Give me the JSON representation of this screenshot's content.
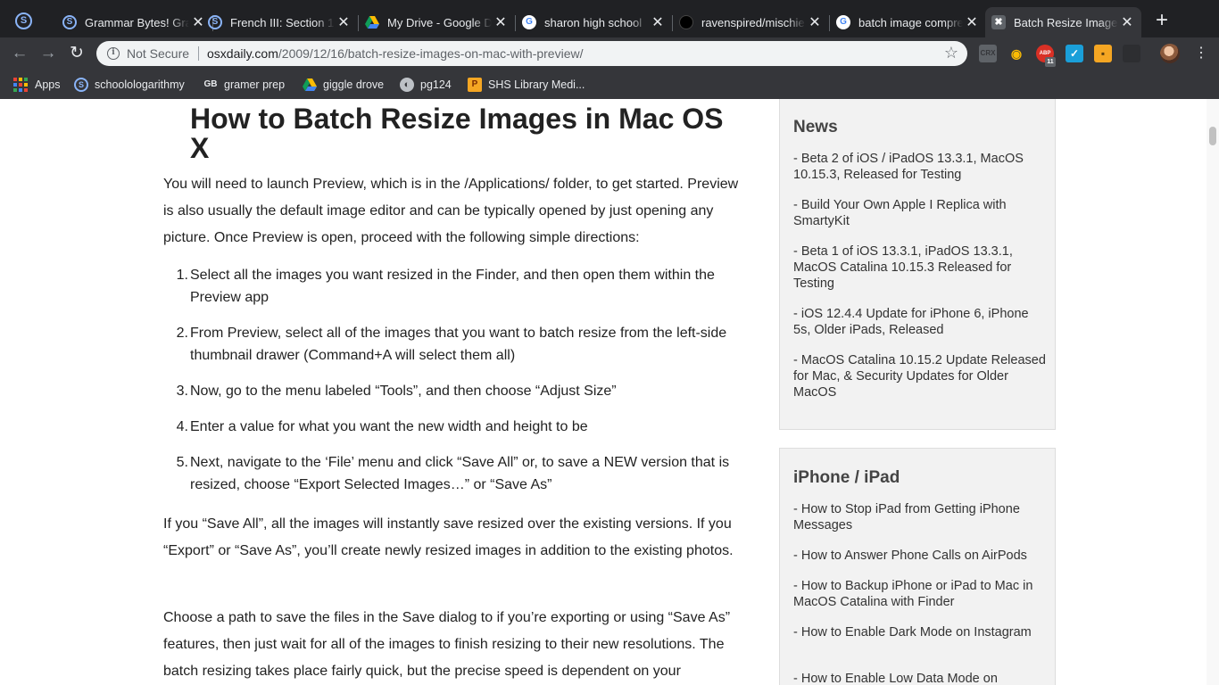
{
  "tabs": [
    {
      "title": "Grammar Bytes! Gra",
      "favicon": "schoology-icon",
      "active": false
    },
    {
      "title": "French III: Section 1",
      "favicon": "schoology-icon",
      "active": false
    },
    {
      "title": "My Drive - Google D",
      "favicon": "google-drive-icon",
      "active": false
    },
    {
      "title": "sharon high school",
      "favicon": "google-icon",
      "active": false
    },
    {
      "title": "ravenspired/mischie",
      "favicon": "github-icon",
      "active": false
    },
    {
      "title": "batch image compre",
      "favicon": "google-icon",
      "active": false
    },
    {
      "title": "Batch Resize Image",
      "favicon": "osxdaily-icon",
      "active": true
    }
  ],
  "toolbar": {
    "security_label": "Not Secure",
    "url_host": "osxdaily.com",
    "url_path": "/2009/12/16/batch-resize-images-on-mac-with-preview/",
    "extensions": [
      {
        "name": "crx-extension-icon",
        "label": "CRX"
      },
      {
        "name": "owl-extension-icon",
        "label": ""
      },
      {
        "name": "abp-extension-icon",
        "label": "ABP",
        "badge": "11"
      },
      {
        "name": "blue-extension-icon",
        "label": ""
      },
      {
        "name": "box-extension-icon",
        "label": ""
      },
      {
        "name": "dark-extension-icon",
        "label": ""
      }
    ]
  },
  "bookmarks": [
    {
      "label": "Apps"
    },
    {
      "label": "schoolologarithmy"
    },
    {
      "label": "gramer prep"
    },
    {
      "label": "giggle drove"
    },
    {
      "label": "pg124"
    },
    {
      "label": "SHS Library Medi..."
    }
  ],
  "article": {
    "title": "How to Batch Resize Images in Mac OS X",
    "intro": "You will need to launch Preview, which is in the /Applications/ folder, to get started. Preview is also usually the default image editor and can be typically opened by just opening any picture. Once Preview is open, proceed with the following simple directions:",
    "steps": [
      "Select all the images you want resized in the Finder, and then open them within the Preview app",
      "From Preview, select all of the images that you want to batch resize from the left-side thumbnail drawer (Command+A will select them all)",
      "Now, go to the menu labeled “Tools”, and then choose “Adjust Size”",
      "Enter a value for what you want the new width and height to be",
      "Next, navigate to the ‘File’ menu and click “Save All” or, to save a NEW version that is resized, choose “Export Selected Images…” or “Save As”"
    ],
    "para2": "If you “Save All”, all the images will instantly save resized over the existing versions. If you “Export” or “Save As”, you’ll create newly resized images in addition to the existing photos.",
    "para3": "Choose a path to save the files in the Save dialog to if you’re exporting or using “Save As” features, then just wait for all of the images to finish resizing to their new resolutions. The batch resizing takes place fairly quick, but the precise speed is dependent on your"
  },
  "sidebar": {
    "news": {
      "heading": "News",
      "links": [
        "- Beta 2 of iOS / iPadOS 13.3.1, MacOS 10.15.3, Released for Testing",
        "- Build Your Own Apple I Replica with SmartyKit",
        "- Beta 1 of iOS 13.3.1, iPadOS 13.3.1, MacOS Catalina 10.15.3 Released for Testing",
        "- iOS 12.4.4 Update for iPhone 6, iPhone 5s, Older iPads, Released",
        "- MacOS Catalina 10.15.2 Update Released for Mac, & Security Updates for Older MacOS"
      ]
    },
    "iphone": {
      "heading": "iPhone / iPad",
      "links": [
        "- How to Stop iPad from Getting iPhone Messages",
        "- How to Answer Phone Calls on AirPods",
        "- How to Backup iPhone or iPad to Mac in MacOS Catalina with Finder",
        "- How to Enable Dark Mode on Instagram",
        "- How to Enable Low Data Mode on"
      ]
    }
  }
}
